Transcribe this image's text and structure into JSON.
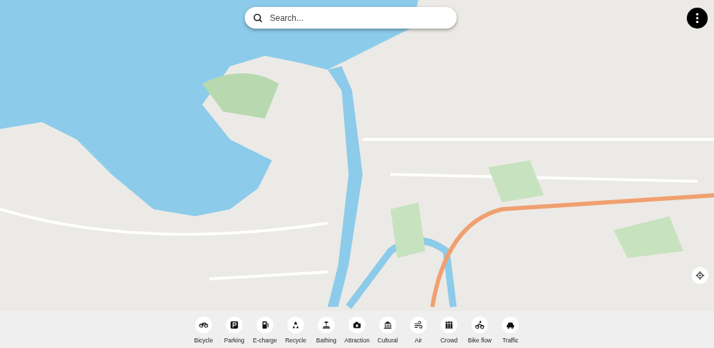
{
  "search": {
    "placeholder": "Search..."
  },
  "categories": [
    {
      "label": "Bicycle",
      "kind": "bicycle"
    },
    {
      "label": "Parking",
      "kind": "parking"
    },
    {
      "label": "E-charge",
      "kind": "echarge"
    },
    {
      "label": "Recycle",
      "kind": "recycle"
    },
    {
      "label": "Bathing",
      "kind": "bathing"
    },
    {
      "label": "Attraction",
      "kind": "attraction"
    },
    {
      "label": "Cultural",
      "kind": "cultural"
    },
    {
      "label": "Air",
      "kind": "air"
    },
    {
      "label": "Crowd",
      "kind": "crowd"
    },
    {
      "label": "Bike flow",
      "kind": "bikeflow"
    },
    {
      "label": "Traffic",
      "kind": "traffic"
    }
  ]
}
